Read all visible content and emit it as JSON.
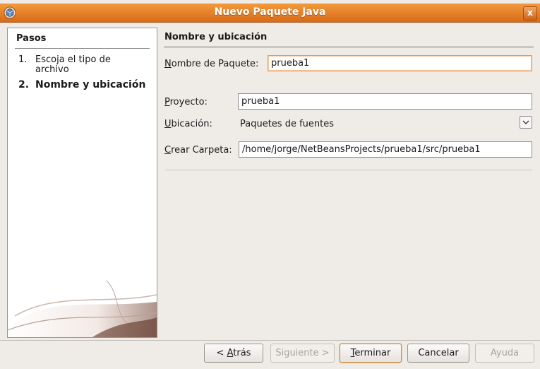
{
  "window": {
    "title": "Nuevo  Paquete Java",
    "close_label": "x"
  },
  "steps": {
    "title": "Pasos",
    "items": [
      {
        "num": "1.",
        "label": "Escoja el tipo de archivo",
        "current": false
      },
      {
        "num": "2.",
        "label": "Nombre y ubicación",
        "current": true
      }
    ]
  },
  "form": {
    "section_title": "Nombre y ubicación",
    "package_name": {
      "label_mnemonic": "N",
      "label_rest": "ombre de Paquete:",
      "value": "prueba1"
    },
    "project": {
      "label_mnemonic": "P",
      "label_rest": "royecto:",
      "value": "prueba1"
    },
    "location": {
      "label_mnemonic": "U",
      "label_rest": "bicación:",
      "value": "Paquetes de fuentes",
      "icon": "chevron-down-icon"
    },
    "folder": {
      "label_mnemonic": "C",
      "label_rest": "rear Carpeta:",
      "value": "/home/jorge/NetBeansProjects/prueba1/src/prueba1"
    }
  },
  "buttons": {
    "back": {
      "prefix": "< ",
      "mnemonic": "A",
      "rest": "trás"
    },
    "next": {
      "label": "Siguiente >",
      "enabled": false
    },
    "finish": {
      "mnemonic": "T",
      "rest": "erminar"
    },
    "cancel": {
      "label": "Cancelar"
    },
    "help": {
      "label": "Ayuda",
      "enabled": false
    }
  },
  "colors": {
    "titlebar": "#e07d26",
    "background": "#efebe7",
    "focus_border": "#e89b58"
  }
}
